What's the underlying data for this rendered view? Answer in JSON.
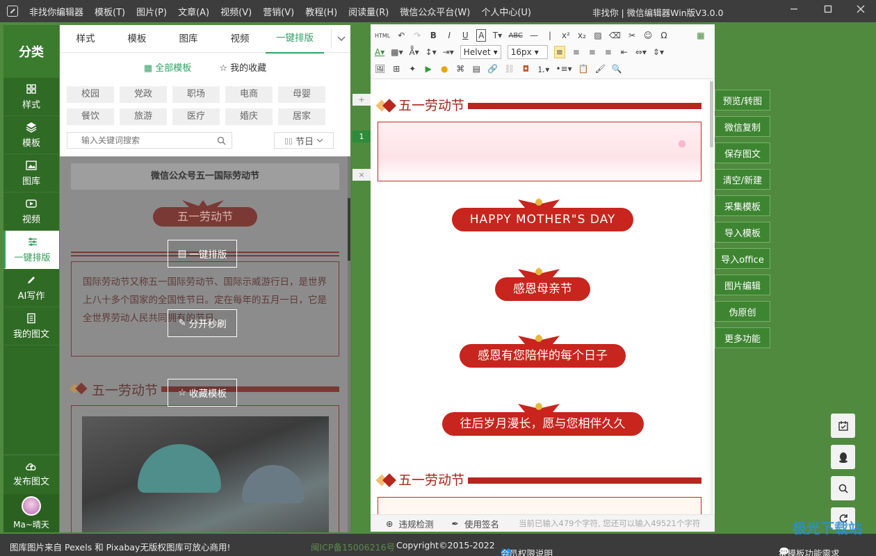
{
  "app": {
    "menu": [
      "非找你编辑器",
      "模板(T)",
      "图片(P)",
      "文章(A)",
      "视频(V)",
      "营销(V)",
      "教程(H)",
      "阅读量(R)",
      "微信公众平台(W)",
      "个人中心(U)"
    ],
    "window_title": "非找你 | 微信编辑器Win版V3.0.0"
  },
  "rail": {
    "header": "分类",
    "items": [
      {
        "label": "样式",
        "icon": "grid-icon"
      },
      {
        "label": "模板",
        "icon": "layers-icon"
      },
      {
        "label": "图库",
        "icon": "image-icon"
      },
      {
        "label": "视频",
        "icon": "video-icon"
      },
      {
        "label": "一键排版",
        "icon": "sliders-icon"
      },
      {
        "label": "AI写作",
        "icon": "pen-icon"
      },
      {
        "label": "我的图文",
        "icon": "document-icon"
      }
    ],
    "publish": "发布图文",
    "user": "Ma~晴天"
  },
  "panel": {
    "tabs": [
      "样式",
      "模板",
      "图库",
      "视频",
      "一键排版"
    ],
    "subtabs": [
      "全部模板",
      "我的收藏"
    ],
    "chips": [
      "校园",
      "党政",
      "职场",
      "电商",
      "母婴",
      "餐饮",
      "旅游",
      "医疗",
      "婚庆",
      "居家"
    ],
    "search_placeholder": "输入关键词搜索",
    "festival": "节日",
    "preview": {
      "title": "微信公众号五一国际劳动节",
      "ribbon": "五一劳动节",
      "paragraph": "国际劳动节又称五一国际劳动节、国际示威游行日，是世界上八十多个国家的全国性节日。定在每年的五月一日，它是全世界劳动人民共同拥有的节日。",
      "section": "五一劳动节",
      "btn_onekey": "一键排版",
      "btn_split": "分开秒刷",
      "btn_fav": "收藏模板"
    }
  },
  "editor": {
    "font": "Helvet",
    "size": "16px",
    "section_title": "五一劳动节",
    "ribbons": [
      "HAPPY MOTHER\"S DAY",
      "感恩母亲节",
      "感恩有您陪伴的每个日子",
      "往后岁月漫长，愿与您相伴久久"
    ],
    "status": {
      "check": "违规检测",
      "sign": "使用签名",
      "count": "当前已输入479个字符, 您还可以输入49521个字符"
    },
    "gutter": [
      "+",
      "1",
      "×"
    ]
  },
  "side_buttons": [
    "预览/转图",
    "微信复制",
    "保存图文",
    "清空/新建",
    "采集模板",
    "导入模板",
    "导入office",
    "图片编辑",
    "伪原创",
    "更多功能"
  ],
  "footer": {
    "left": "图库图片来自 Pexels 和 Pixabay无版权图库可放心商用!",
    "icp": "闽ICP备15006216号",
    "copyright": "Copyright©2015-2022",
    "member": "会员权限说明",
    "feedback": "提模板功能需求",
    "watermark": "极光下载站"
  },
  "colors": {
    "brand_green": "#2ea163",
    "rail_green": "#2f6b25",
    "festival_red": "#c7251d"
  }
}
